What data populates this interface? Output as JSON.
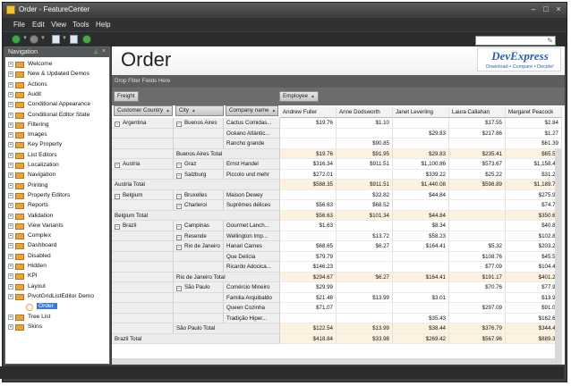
{
  "window": {
    "title": "Order - FeatureCenter"
  },
  "menu": [
    "File",
    "Edit",
    "View",
    "Tools",
    "Help"
  ],
  "nav": {
    "header": "Navigation",
    "items": [
      {
        "label": "Welcome",
        "icon": "welcome-icon"
      },
      {
        "label": "New & Updated Demos",
        "icon": "folder-icon"
      },
      {
        "label": "Actions",
        "icon": "folder-icon"
      },
      {
        "label": "Audit",
        "icon": "folder-icon"
      },
      {
        "label": "Conditional Appearance",
        "icon": "folder-icon"
      },
      {
        "label": "Conditional Editor State",
        "icon": "folder-icon"
      },
      {
        "label": "Filtering",
        "icon": "folder-icon"
      },
      {
        "label": "Images",
        "icon": "folder-icon"
      },
      {
        "label": "Key Property",
        "icon": "folder-icon"
      },
      {
        "label": "List Editors",
        "icon": "folder-icon"
      },
      {
        "label": "Localization",
        "icon": "folder-icon"
      },
      {
        "label": "Navigation",
        "icon": "folder-icon"
      },
      {
        "label": "Printing",
        "icon": "folder-icon"
      },
      {
        "label": "Property Editors",
        "icon": "folder-icon"
      },
      {
        "label": "Reports",
        "icon": "folder-icon"
      },
      {
        "label": "Validation",
        "icon": "folder-icon"
      },
      {
        "label": "View Variants",
        "icon": "folder-icon"
      },
      {
        "label": "Complex",
        "icon": "folder-icon"
      },
      {
        "label": "Dashboard",
        "icon": "folder-icon"
      },
      {
        "label": "Disabled",
        "icon": "folder-icon"
      },
      {
        "label": "Hidden",
        "icon": "folder-icon"
      },
      {
        "label": "KPI",
        "icon": "folder-icon"
      },
      {
        "label": "Layout",
        "icon": "folder-icon"
      },
      {
        "label": "PivotGridListEditor Demo",
        "icon": "folder-icon"
      },
      {
        "label": "Order",
        "icon": "order-icon",
        "child": true,
        "selected": true
      },
      {
        "label": "Tree List",
        "icon": "folder-icon"
      },
      {
        "label": "Skins",
        "icon": "folder-icon"
      }
    ]
  },
  "page": {
    "title": "Order"
  },
  "logo": {
    "name": "DevExpress",
    "tagline": "Download • Compare • Decide!"
  },
  "pivot": {
    "filter_hint": "Drop Filter Fields Here",
    "data_field": "Freight",
    "column_field": "Employee",
    "row_fields": [
      "Customer Country",
      "City",
      "Company name"
    ],
    "employees": [
      "Andrew Fuller",
      "Anne Dodsworth",
      "Janet Leverling",
      "Laura Callahan",
      "Margaret Peacock"
    ],
    "rows": [
      {
        "country": "Argentina",
        "city": "Buenos Aires",
        "company": "Cactus Comidas...",
        "v": [
          "$19.76",
          "$1.10",
          "",
          "$17.55",
          "$2.84"
        ]
      },
      {
        "company": "Océano Atlántic...",
        "v": [
          "",
          "",
          "$29.83",
          "$217.86",
          "$1.27"
        ]
      },
      {
        "company": "Rancho grande",
        "v": [
          "",
          "$90.85",
          "",
          "",
          "$61.39"
        ]
      },
      {
        "citytotal": "Buenos Aires Total",
        "v": [
          "$19.76",
          "$91.95",
          "$29.83",
          "$235.41",
          "$65.50"
        ]
      },
      {
        "country": "Austria",
        "city": "Graz",
        "company": "Ernst Handel",
        "v": [
          "$316.34",
          "$911.51",
          "$1,100.86",
          "$573.67",
          "$1,158.45"
        ]
      },
      {
        "city": "Salzburg",
        "company": "Piccolo und mehr",
        "v": [
          "$272.01",
          "",
          "$339.22",
          "$25.22",
          "$31.29"
        ]
      },
      {
        "countrytotal": "Austria Total",
        "v": [
          "$588.35",
          "$911.51",
          "$1,440.08",
          "$598.89",
          "$1,189.74"
        ]
      },
      {
        "country": "Belgium",
        "city": "Bruxelles",
        "company": "Maison Dewey",
        "v": [
          "",
          "$32.82",
          "$44.84",
          "",
          "$275.91"
        ]
      },
      {
        "city": "Charleroi",
        "company": "Suprêmes délices",
        "v": [
          "$56.63",
          "$68.52",
          "",
          "",
          "$74.71"
        ]
      },
      {
        "countrytotal": "Belgium Total",
        "v": [
          "$56.63",
          "$101.34",
          "$44.84",
          "",
          "$350.62"
        ]
      },
      {
        "country": "Brazil",
        "city": "Campinas",
        "company": "Gourmet Lanch...",
        "v": [
          "$1.63",
          "",
          "$8.34",
          "",
          "$40.89"
        ]
      },
      {
        "city": "Resende",
        "company": "Wellington Imp...",
        "v": [
          "",
          "$13.72",
          "$58.23",
          "",
          "$102.82"
        ]
      },
      {
        "city": "Rio de Janeiro",
        "company": "Hanari Carnes",
        "v": [
          "$68.65",
          "$6.27",
          "$164.41",
          "$5.32",
          "$203.22"
        ]
      },
      {
        "company": "Que Delícia",
        "v": [
          "$79.79",
          "",
          "",
          "$108.76",
          "$45.59"
        ]
      },
      {
        "company": "Ricardo Adocica...",
        "v": [
          "$146.23",
          "",
          "",
          "$77.09",
          "$104.49"
        ]
      },
      {
        "citytotal": "Rio de Janeiro Total",
        "v": [
          "$294.67",
          "$6.27",
          "$164.41",
          "$191.17",
          "$401.20"
        ]
      },
      {
        "city": "São Paulo",
        "company": "Comércio Mineiro",
        "v": [
          "$29.99",
          "",
          "",
          "$70.76",
          "$77.92"
        ]
      },
      {
        "company": "Familia Arquibaldo",
        "v": [
          "$21.48",
          "$13.99",
          "$3.01",
          "",
          "$13.92"
        ]
      },
      {
        "company": "Queen Cozinha",
        "v": [
          "$71.07",
          "",
          "",
          "$297.09",
          "$91.09"
        ]
      },
      {
        "company": "Tradição Hiper...",
        "v": [
          "",
          "",
          "$35.43",
          "",
          "$162.61"
        ]
      },
      {
        "citytotal": "São Paulo Total",
        "v": [
          "$122.54",
          "$13.99",
          "$38.44",
          "$376.79",
          "$344.46"
        ]
      },
      {
        "countrytotal": "Brazil Total",
        "v": [
          "$418.84",
          "$33.98",
          "$269.42",
          "$567.96",
          "$889.37"
        ]
      }
    ]
  }
}
